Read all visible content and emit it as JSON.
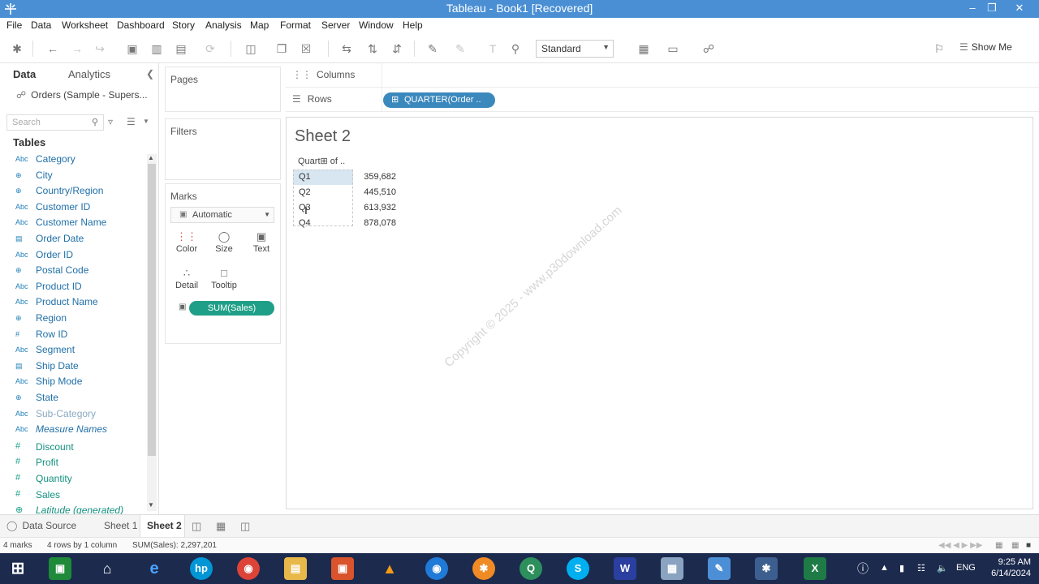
{
  "window": {
    "title": "Tableau - Book1 [Recovered]"
  },
  "menu": [
    "File",
    "Data",
    "Worksheet",
    "Dashboard",
    "Story",
    "Analysis",
    "Map",
    "Format",
    "Server",
    "Window",
    "Help"
  ],
  "toolbar": {
    "fit_select": "Standard",
    "show_me": "Show Me"
  },
  "data_pane": {
    "tab_data": "Data",
    "tab_analytics": "Analytics",
    "datasource": "Orders (Sample - Supers...",
    "search_placeholder": "Search",
    "tables_header": "Tables",
    "dimensions": [
      {
        "type": "Abc",
        "name": "Category"
      },
      {
        "type": "globe",
        "name": "City"
      },
      {
        "type": "globe",
        "name": "Country/Region"
      },
      {
        "type": "Abc",
        "name": "Customer ID"
      },
      {
        "type": "Abc",
        "name": "Customer Name"
      },
      {
        "type": "date",
        "name": "Order Date"
      },
      {
        "type": "Abc",
        "name": "Order ID"
      },
      {
        "type": "globe",
        "name": "Postal Code"
      },
      {
        "type": "Abc",
        "name": "Product ID"
      },
      {
        "type": "Abc",
        "name": "Product Name"
      },
      {
        "type": "globe",
        "name": "Region"
      },
      {
        "type": "#",
        "name": "Row ID"
      },
      {
        "type": "Abc",
        "name": "Segment"
      },
      {
        "type": "date",
        "name": "Ship Date"
      },
      {
        "type": "Abc",
        "name": "Ship Mode"
      },
      {
        "type": "globe",
        "name": "State"
      },
      {
        "type": "Abc",
        "name": "Sub-Category"
      },
      {
        "type": "Abc",
        "name": "Measure Names"
      }
    ],
    "measures": [
      {
        "type": "#",
        "name": "Discount"
      },
      {
        "type": "#",
        "name": "Profit"
      },
      {
        "type": "#",
        "name": "Quantity"
      },
      {
        "type": "#",
        "name": "Sales"
      },
      {
        "type": "globe",
        "name": "Latitude (generated)"
      }
    ]
  },
  "shelves": {
    "pages": "Pages",
    "filters": "Filters",
    "marks": "Marks",
    "mark_type": "Automatic",
    "mark_buttons": [
      "Color",
      "Size",
      "Text",
      "Detail",
      "Tooltip"
    ],
    "text_pill": "SUM(Sales)",
    "columns_label": "Columns",
    "rows_label": "Rows",
    "rows_pill": "QUARTER(Order .."
  },
  "sheet": {
    "title": "Sheet 2",
    "column_header": "Quart⊞ of ..",
    "rows": [
      {
        "quarter": "Q1",
        "value": "359,682"
      },
      {
        "quarter": "Q2",
        "value": "445,510"
      },
      {
        "quarter": "Q3",
        "value": "613,932"
      },
      {
        "quarter": "Q4",
        "value": "878,078"
      }
    ],
    "watermark": "Copyright © 2025 - www.p30download.com"
  },
  "tabs": {
    "data_source": "Data Source",
    "sheet1": "Sheet 1",
    "sheet2": "Sheet 2"
  },
  "status": {
    "marks": "4 marks",
    "dims": "4 rows by 1 column",
    "sum": "SUM(Sales): 2,297,201"
  },
  "taskbar": {
    "lang": "ENG",
    "time": "9:25 AM",
    "date": "6/14/2024"
  },
  "colors": {
    "titlebar": "#4a8fd4",
    "dimension_pill": "#3b88bd",
    "measure_pill": "#1f9f87",
    "taskbar": "#1c2a4e"
  }
}
